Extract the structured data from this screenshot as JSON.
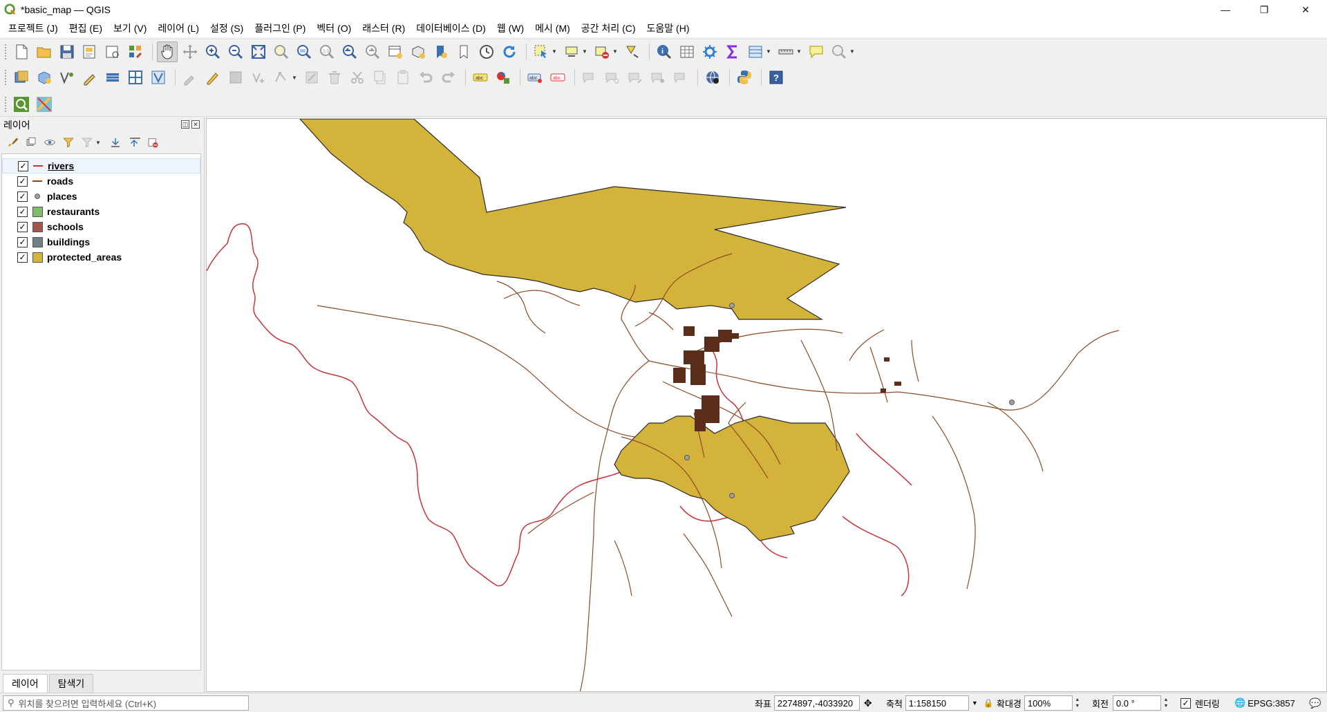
{
  "window": {
    "title": "*basic_map — QGIS",
    "minimize": "—",
    "restore": "❐",
    "close": "✕"
  },
  "menu": [
    "프로젝트 (J)",
    "편집 (E)",
    "보기 (V)",
    "레이어 (L)",
    "설정 (S)",
    "플러그인 (P)",
    "벡터 (O)",
    "래스터 (R)",
    "데이터베이스 (D)",
    "웹 (W)",
    "메시 (M)",
    "공간 처리 (C)",
    "도움말 (H)"
  ],
  "layers_panel": {
    "title": "레이어",
    "layers": [
      {
        "name": "rivers",
        "checked": "✓",
        "symbol": "line",
        "color": "#c83232",
        "selected": true
      },
      {
        "name": "roads",
        "checked": "✓",
        "symbol": "line",
        "color": "#8b4513",
        "selected": false
      },
      {
        "name": "places",
        "checked": "✓",
        "symbol": "dot",
        "color": "#a0a0a0",
        "selected": false
      },
      {
        "name": "restaurants",
        "checked": "✓",
        "symbol": "fill",
        "color": "#7fbf6a",
        "selected": false
      },
      {
        "name": "schools",
        "checked": "✓",
        "symbol": "fill",
        "color": "#a0584a",
        "selected": false
      },
      {
        "name": "buildings",
        "checked": "✓",
        "symbol": "fill",
        "color": "#6f7f86",
        "selected": false
      },
      {
        "name": "protected_areas",
        "checked": "✓",
        "symbol": "fill",
        "color": "#d4b33a",
        "selected": false
      }
    ],
    "tabs": [
      "레이어",
      "탐색기"
    ]
  },
  "map": {
    "protected_fill": "#d4b33a",
    "protected_stroke": "#2b2b2b",
    "road_color": "#8b4a26",
    "river_color": "#c8323a",
    "building_color": "#5a2e1a"
  },
  "status": {
    "locator_placeholder": "위치를 찾으려면 입력하세요 (Ctrl+K)",
    "coord_label": "좌표",
    "coord_value": "2274897,-4033920",
    "scale_label": "축척",
    "scale_value": "1:158150",
    "magnifier_label": "확대경",
    "magnifier_value": "100%",
    "rotation_label": "회전",
    "rotation_value": "0.0 °",
    "render_label": "렌더링",
    "render_checked": "✓",
    "crs": "EPSG:3857"
  }
}
